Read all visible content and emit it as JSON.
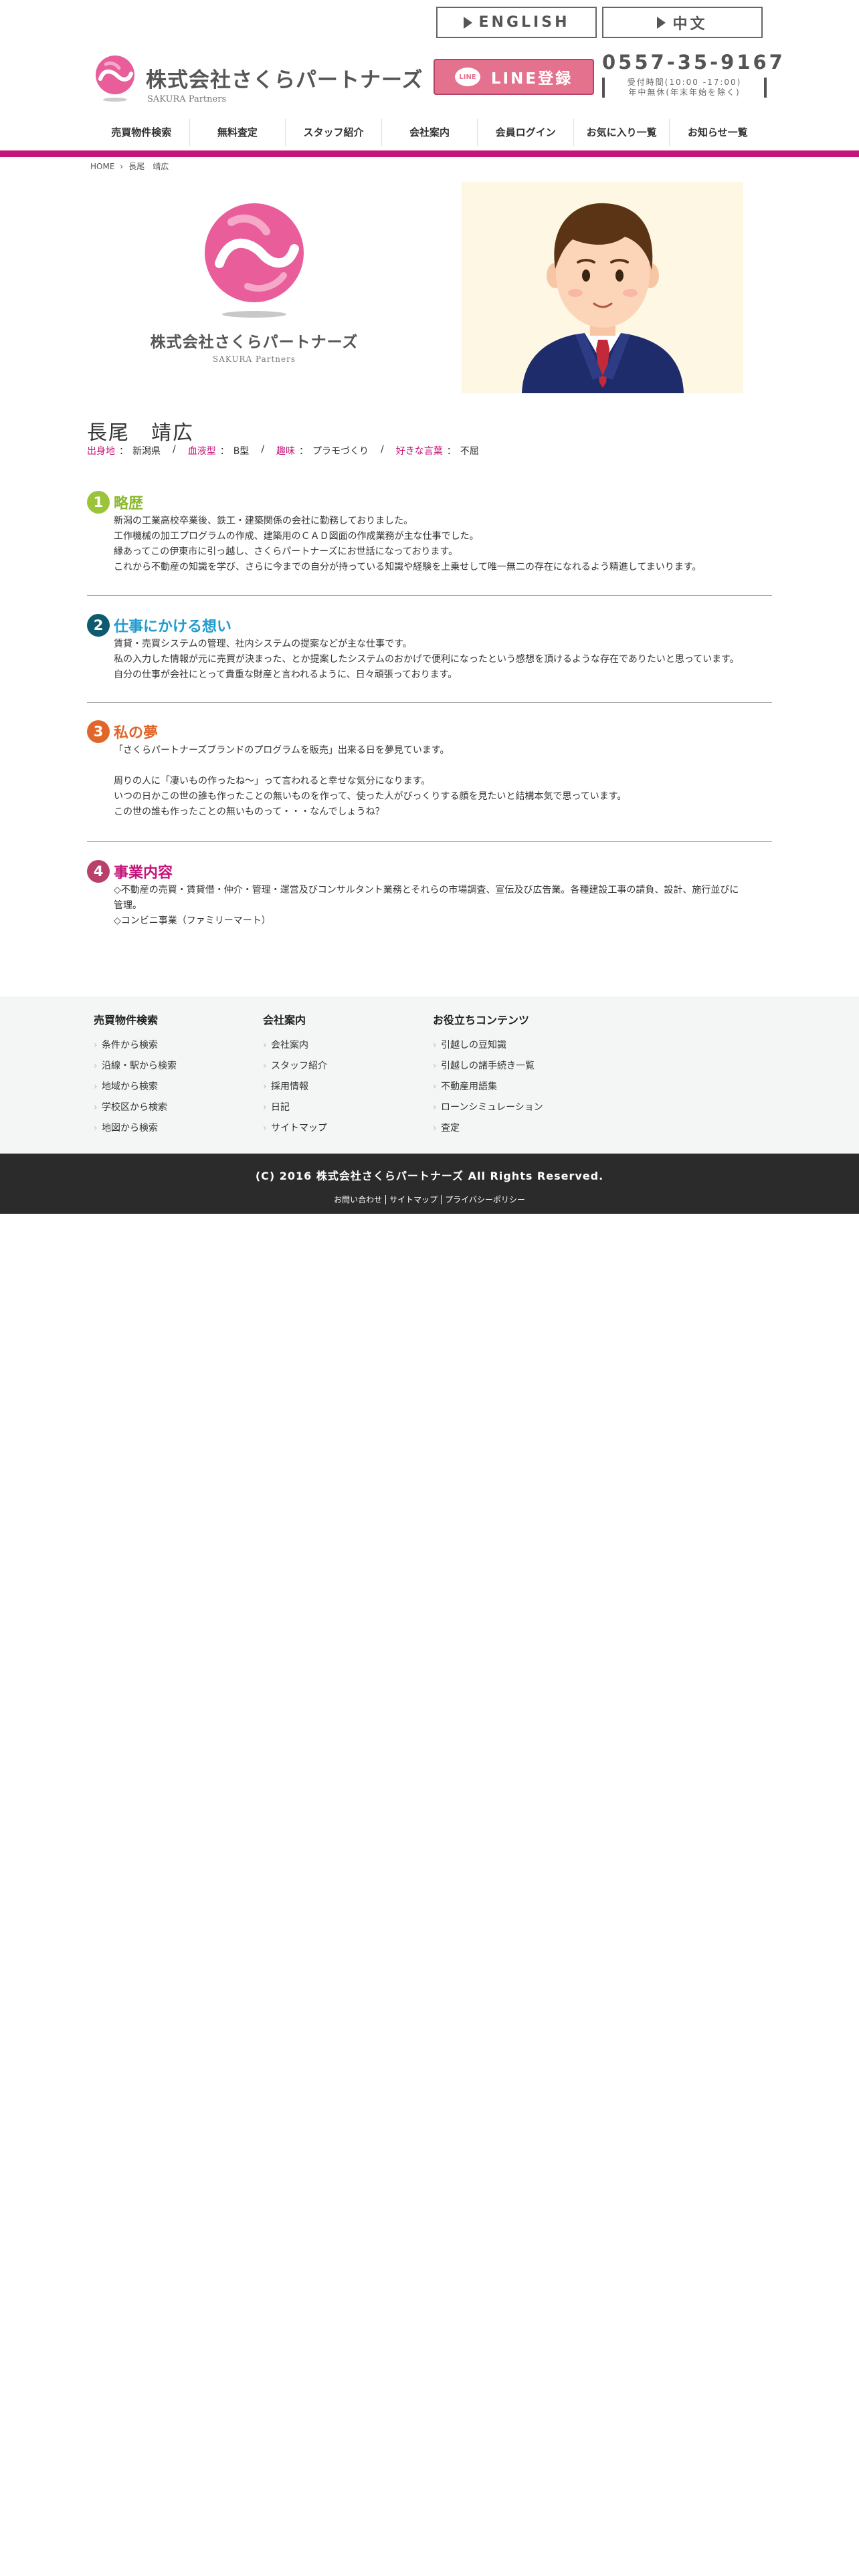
{
  "header": {
    "lang_buttons": [
      "ENGLISH",
      "中文"
    ],
    "logo_jp": "株式会社さくらパートナーズ",
    "logo_en": "SAKURA Partners",
    "line_badge": "LINE",
    "line_button": "LINE登録",
    "phone": "0557-35-9167",
    "hours": "受付時間(10:00 -17:00)",
    "holiday": "年中無休(年末年始を除く)"
  },
  "nav": [
    "売買物件検索",
    "無料査定",
    "スタッフ紹介",
    "会社案内",
    "会員ログイン",
    "お気に入り一覧",
    "お知らせ一覧"
  ],
  "breadcrumb": {
    "home": "HOME",
    "current": "長尾　靖広"
  },
  "hero": {
    "logo_jp": "株式会社さくらパートナーズ",
    "logo_en": "SAKURA Partners"
  },
  "profile": {
    "name": "長尾　靖広",
    "fields": [
      {
        "key": "出身地",
        "value": "新潟県"
      },
      {
        "key": "血液型",
        "value": "B型"
      },
      {
        "key": "趣味",
        "value": "プラモづくり"
      },
      {
        "key": "好きな言葉",
        "value": "不屈"
      }
    ]
  },
  "sections": [
    {
      "num": "1",
      "title": "略歴",
      "color": "#8cb92f",
      "lines": [
        "新潟の工業高校卒業後、鉄工・建築関係の会社に勤務しておりました。",
        "工作機械の加工プログラムの作成、建築用のＣＡＤ図面の作成業務が主な仕事でした。",
        "縁あってこの伊東市に引っ越し、さくらパートナーズにお世話になっております。",
        "これから不動産の知識を学び、さらに今までの自分が持っている知識や経験を上乗せして唯一無二の存在になれるよう精進してまいります。"
      ]
    },
    {
      "num": "2",
      "title": "仕事にかける想い",
      "color": "#1f9ccf",
      "badge": "#0e5a6e",
      "lines": [
        "賃貸・売買システムの管理、社内システムの提案などが主な仕事です。",
        "私の入力した情報が元に売買が決まった、とか提案したシステムのおかげで便利になったという感想を頂けるような存在でありたいと思っています。",
        "自分の仕事が会社にとって貴重な財産と言われるように、日々頑張っております。"
      ]
    },
    {
      "num": "3",
      "title": "私の夢",
      "color": "#e0662a",
      "lines": [
        "「さくらパートナーズブランドのプログラムを販売」出来る日を夢見ています。",
        "",
        "周りの人に「凄いもの作ったね～」って言われると幸せな気分になります。",
        "いつの日かこの世の誰も作ったことの無いものを作って、使った人がびっくりする顔を見たいと結構本気で思っています。",
        "この世の誰も作ったことの無いものって・・・なんでしょうね？"
      ]
    },
    {
      "num": "4",
      "title": "事業内容",
      "color": "#c4157a",
      "badge": "#b8406a",
      "lines": [
        "◇不動産の売買・賃貸借・仲介・管理・運営及びコンサルタント業務とそれらの市場調査、宣伝及び広告業。各種建設工事の請負、設計、施行並びに",
        "管理。",
        "◇コンビニ事業（ファミリーマート）"
      ]
    }
  ],
  "footer": {
    "columns": [
      {
        "title": "売買物件検索",
        "links": [
          "条件から検索",
          "沿線・駅から検索",
          "地域から検索",
          "学校区から検索",
          "地図から検索"
        ]
      },
      {
        "title": "会社案内",
        "links": [
          "会社案内",
          "スタッフ紹介",
          "採用情報",
          "日記",
          "サイトマップ"
        ]
      },
      {
        "title": "お役立ちコンテンツ",
        "links": [
          "引越しの豆知識",
          "引越しの諸手続き一覧",
          "不動産用語集",
          "ローンシミュレーション",
          "査定"
        ]
      }
    ],
    "copyright": "(C) 2016 株式会社さくらパートナーズ All Rights Reserved.",
    "bottom_links": [
      "お問い合わせ",
      "サイトマップ",
      "プライバシーポリシー"
    ]
  },
  "colors": {
    "brand_pink": "#c4157a",
    "line_pink": "#e4718e",
    "footer_dark": "#2b2b2b"
  }
}
